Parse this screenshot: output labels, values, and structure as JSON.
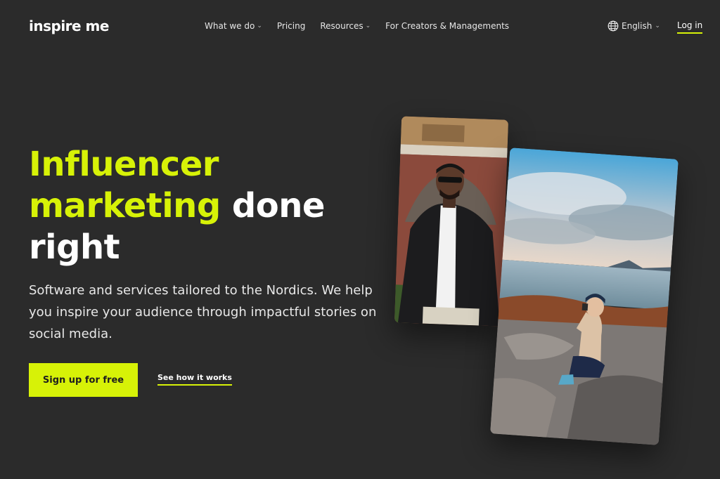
{
  "header": {
    "logo_text": "inspire me",
    "nav": [
      {
        "label": "What we do",
        "has_dropdown": true
      },
      {
        "label": "Pricing",
        "has_dropdown": false
      },
      {
        "label": "Resources",
        "has_dropdown": true
      },
      {
        "label": "For Creators & Managements",
        "has_dropdown": false
      }
    ],
    "language": {
      "label": "English",
      "icon": "globe-icon"
    },
    "login_label": "Log in"
  },
  "hero": {
    "title_accent_1": "Influencer",
    "title_accent_2": "marketing",
    "title_rest_1": "done",
    "title_rest_2": "right",
    "subtitle": "Software and services tailored to the Nordics. We help you inspire your audience through impactful stories on social media.",
    "cta_primary": "Sign up for free",
    "cta_secondary": "See how it works"
  },
  "colors": {
    "background": "#2b2b2b",
    "accent": "#d7f207",
    "text": "#ffffff"
  }
}
